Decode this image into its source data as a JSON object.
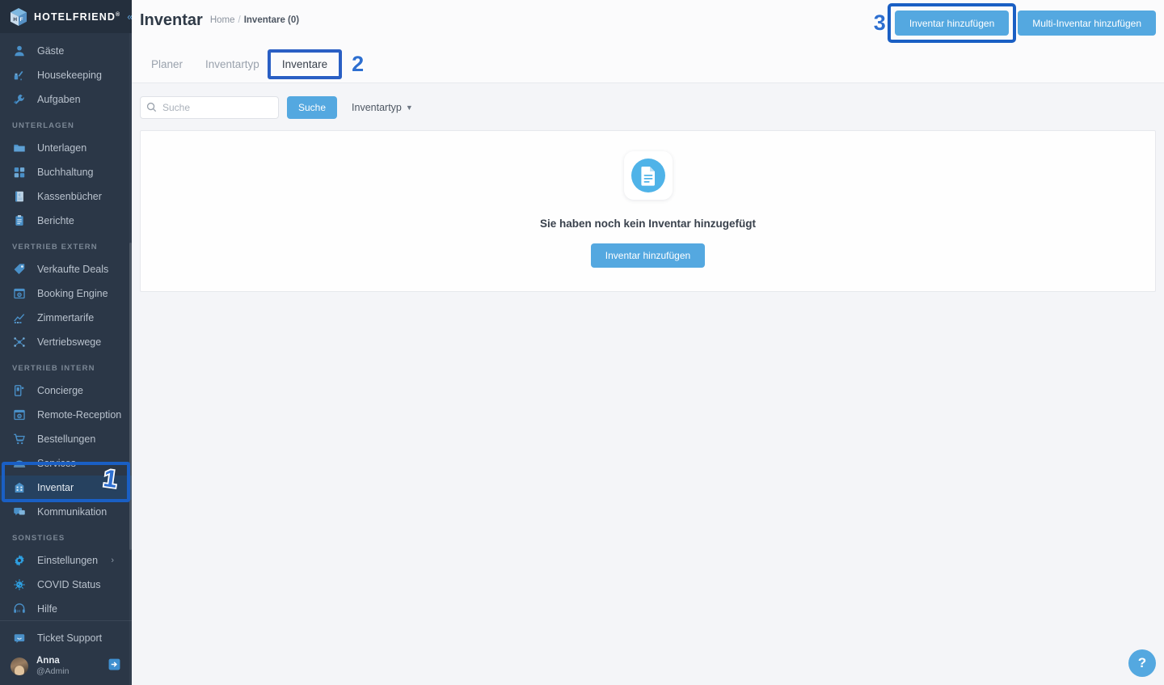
{
  "brand": {
    "name": "HOTELFRIEND",
    "registered_mark": "®",
    "logo_icon": "hotelfriend-cube-logo",
    "collapse_icon": "chevron-double-left-icon"
  },
  "sidebar": {
    "groups": [
      {
        "label": null,
        "items": [
          {
            "label": "Gäste",
            "icon": "user-icon",
            "active": false
          },
          {
            "label": "Housekeeping",
            "icon": "broom-icon",
            "active": false
          },
          {
            "label": "Aufgaben",
            "icon": "wrench-icon",
            "active": false
          }
        ]
      },
      {
        "label": "UNTERLAGEN",
        "items": [
          {
            "label": "Unterlagen",
            "icon": "folder-icon",
            "active": false
          },
          {
            "label": "Buchhaltung",
            "icon": "calculator-icon",
            "active": false
          },
          {
            "label": "Kassenbücher",
            "icon": "cash-book-icon",
            "active": false
          },
          {
            "label": "Berichte",
            "icon": "clipboard-icon",
            "active": false
          }
        ]
      },
      {
        "label": "VERTRIEB EXTERN",
        "items": [
          {
            "label": "Verkaufte Deals",
            "icon": "tag-icon",
            "active": false
          },
          {
            "label": "Booking Engine",
            "icon": "browser-gear-icon",
            "active": false
          },
          {
            "label": "Zimmertarife",
            "icon": "chart-line-icon",
            "active": false
          },
          {
            "label": "Vertriebswege",
            "icon": "network-nodes-icon",
            "active": false
          }
        ]
      },
      {
        "label": "VERTRIEB INTERN",
        "items": [
          {
            "label": "Concierge",
            "icon": "mobile-concierge-icon",
            "active": false
          },
          {
            "label": "Remote-Reception",
            "icon": "browser-gear-icon",
            "active": false
          },
          {
            "label": "Bestellungen",
            "icon": "shopping-cart-icon",
            "active": false
          },
          {
            "label": "Services",
            "icon": "bell-service-icon",
            "active": false
          },
          {
            "label": "Inventar",
            "icon": "inventory-grid-icon",
            "active": true
          },
          {
            "label": "Kommunikation",
            "icon": "chat-bubble-icon",
            "active": false
          }
        ]
      },
      {
        "label": "SONSTIGES",
        "items": [
          {
            "label": "Einstellungen",
            "icon": "gear-icon",
            "active": false,
            "chevron": "›"
          },
          {
            "label": "COVID Status",
            "icon": "virus-icon",
            "active": false
          },
          {
            "label": "Hilfe",
            "icon": "headset-24-icon",
            "active": false
          }
        ]
      }
    ],
    "footer": {
      "support_label": "Ticket Support",
      "support_icon": "ticket-chat-icon",
      "user_name": "Anna",
      "user_role": "@Admin",
      "avatar_icon": "user-avatar",
      "logout_icon": "logout-arrow-icon"
    }
  },
  "header": {
    "title": "Inventar",
    "breadcrumb": {
      "home": "Home",
      "separator": "/",
      "current": "Inventare (0)"
    },
    "buttons": {
      "primary": "Inventar hinzufügen",
      "secondary": "Multi-Inventar hinzufügen"
    }
  },
  "tabs": [
    {
      "label": "Planer",
      "active": false
    },
    {
      "label": "Inventartyp",
      "active": false
    },
    {
      "label": "Inventare",
      "active": true
    }
  ],
  "filters": {
    "search_placeholder": "Suche",
    "search_value": "",
    "search_icon": "search-icon",
    "search_button": "Suche",
    "type_dropdown_label": "Inventartyp",
    "type_dropdown_caret": "chevron-down-icon"
  },
  "empty_state": {
    "icon": "document-empty-icon",
    "message": "Sie haben noch kein Inventar hinzugefügt",
    "action_label": "Inventar hinzufügen"
  },
  "help": {
    "label": "?",
    "icon": "question-mark-icon"
  },
  "annotations": [
    {
      "number": "1",
      "target": "sidebar-item-inventar"
    },
    {
      "number": "2",
      "target": "tab-inventare"
    },
    {
      "number": "3",
      "target": "add-inventory-button"
    }
  ],
  "colors": {
    "sidebar_bg": "#2b3747",
    "sidebar_header_bg": "#242f3d",
    "accent_blue": "#54a8e0",
    "icon_blue": "#4a90c8",
    "highlight_blue": "#1a5fc4",
    "active_item_bg": "#26415f",
    "content_bg": "#f4f5f8"
  }
}
